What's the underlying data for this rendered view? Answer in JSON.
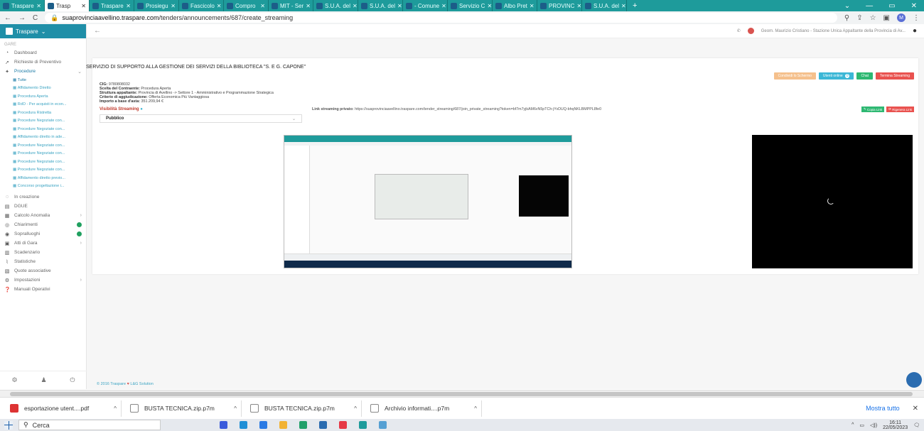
{
  "browser": {
    "tabs": [
      {
        "label": "Traspare"
      },
      {
        "label": "Trasp",
        "active": true
      },
      {
        "label": "Traspare"
      },
      {
        "label": "Prosiegu"
      },
      {
        "label": "Fascicolo"
      },
      {
        "label": "Compro"
      },
      {
        "label": "MIT - Ser"
      },
      {
        "label": "S.U.A. del"
      },
      {
        "label": "S.U.A. del"
      },
      {
        "label": "- Comune"
      },
      {
        "label": "Servizio C"
      },
      {
        "label": "Albo Pret"
      },
      {
        "label": "PROVINC"
      },
      {
        "label": "S.U.A. del"
      }
    ],
    "new_tab": "+",
    "url_host": "suaprovinciaavellino.traspare.com",
    "url_path": "/tenders/announcements/687/create_streaming",
    "profile_initial": "M"
  },
  "sidebar": {
    "brand": "Traspare",
    "section": "GARE",
    "items_top": [
      {
        "icon": "◔",
        "label": "Dashboard"
      },
      {
        "icon": "➚",
        "label": "Richieste di Preventivo"
      },
      {
        "icon": "✦",
        "label": "Procedure",
        "chevron": "⌄"
      }
    ],
    "subitems": [
      "Tutte",
      "Affidamento Diretto",
      "Procedura Aperta",
      "RdO - Per acquisti in econ...",
      "Procedura Ristretta",
      "Procedure Negoziate con...",
      "Procedure Negoziate con...",
      "Affidamento diretto in ade...",
      "Procedure Negoziate con...",
      "Procedure Negoziate con...",
      "Procedure Negoziate con...",
      "Procedure Negoziate con...",
      "Affidamento diretto previo...",
      "Concorso progettazione i..."
    ],
    "items_bottom": [
      {
        "icon": "◌",
        "label": "In creazione"
      },
      {
        "icon": "▤",
        "label": "DGUE"
      },
      {
        "icon": "▦",
        "label": "Calcolo Anomalia",
        "chevron": "›"
      },
      {
        "icon": "◎",
        "label": "Chiarimenti",
        "badge": true
      },
      {
        "icon": "◉",
        "label": "Sopralluoghi",
        "badge": true
      },
      {
        "icon": "▣",
        "label": "Atti di Gara",
        "chevron": "›"
      },
      {
        "icon": "▥",
        "label": "Scadenzario"
      },
      {
        "icon": "⌇",
        "label": "Statistiche"
      },
      {
        "icon": "▧",
        "label": "Quote associative"
      },
      {
        "icon": "⚙",
        "label": "Impostazioni",
        "chevron": "›"
      },
      {
        "icon": "❓",
        "label": "Manuali Operativi"
      }
    ],
    "footer_icons": [
      "⚙",
      "♟",
      "⏻"
    ]
  },
  "topbar": {
    "back": "←",
    "user_text": "Geom. Maurizio Cristiano - Stazione Unica Appaltante della Provincia di Av..."
  },
  "page": {
    "title": "SERVIZIO DI SUPPORTO ALLA GESTIONE DEI SERVIZI DELLA BIBLIOTECA \"S. E G. CAPONE\"",
    "buttons": [
      {
        "label": "Condividi lo Schermo",
        "color": "#f5c08c"
      },
      {
        "label": "Utenti online",
        "color": "#3cb7d6"
      },
      {
        "label": "Chat",
        "color": "#2eb872"
      },
      {
        "label": "Termina Streaming",
        "color": "#e9524f"
      }
    ],
    "online_count": "0",
    "info": [
      {
        "label": "CIG:",
        "value": "9780808032"
      },
      {
        "label": "Scelta del Contraente:",
        "value": "Procedura Aperta"
      },
      {
        "label": "Struttura appaltante:",
        "value": "Provincia di Avellino -> Settore 1 - Amministrativo e Programmazione Strategica"
      },
      {
        "label": "Criterio di aggiudicazione:",
        "value": "Offerta Economica Più Vantaggiosa"
      },
      {
        "label": "Importo a base d'asta:",
        "value": "351.209,94 €"
      }
    ],
    "visibility_label": "Visibilità Streaming",
    "visibility_value": "Pubblico",
    "link_label": "Link streaming privato:",
    "link_value": "https://suaprovinciaavellino.traspare.com/tender_streaming/687/join_private_streaming?token=bf7m7yjkAM6vN5pTCh-jYvDUQ-bhqNKLBMPPL8fe0",
    "copy_link": "Copia Link",
    "regen_link": "Rigenera Link",
    "footer": "© 2016 Traspare",
    "footer_suffix": "L&G Solution"
  },
  "downloads": {
    "items": [
      {
        "name": "esportazione utent....pdf",
        "pdf": true
      },
      {
        "name": "BUSTA TECNICA.zip.p7m"
      },
      {
        "name": "BUSTA TECNICA.zip.p7m"
      },
      {
        "name": "Archivio informati....p7m"
      }
    ],
    "show_all": "Mostra tutto",
    "close": "✕"
  },
  "taskbar": {
    "search_placeholder": "Cerca",
    "time": "16:11",
    "date": "22/05/2023",
    "app_colors": [
      "#3b5bdb",
      "#1f8fd6",
      "#2a7ae4",
      "#f2b233",
      "#22a06b",
      "#2b6cb0",
      "#e63946",
      "#1e9b9b",
      "#56a0d3"
    ]
  }
}
